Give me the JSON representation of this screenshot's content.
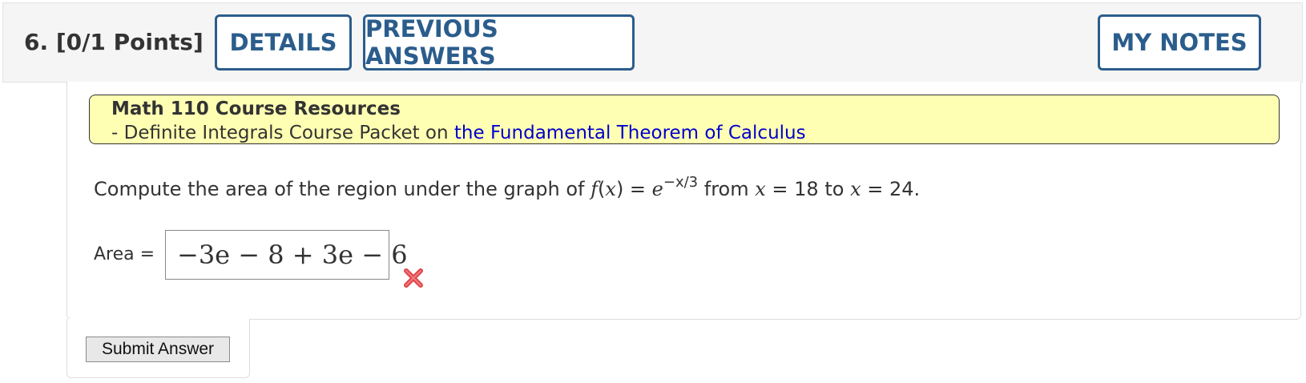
{
  "header": {
    "question_label": "6.  [0/1 Points]",
    "details_label": "DETAILS",
    "previous_answers_label": "PREVIOUS ANSWERS",
    "my_notes_label": "MY NOTES"
  },
  "resources": {
    "title": "Math 110 Course Resources",
    "prefix": "- Definite Integrals Course Packet on ",
    "link": "the Fundamental Theorem of Calculus"
  },
  "question": {
    "part1": "Compute the area of the region under the graph of ",
    "f": "f",
    "part2": "(",
    "x1": "x",
    "part3": ") = ",
    "e": "e",
    "exponent": "−x/3",
    "part4": " from ",
    "x2": "x",
    "part5": " = 18 to ",
    "x3": "x",
    "part6": " = 24."
  },
  "answer": {
    "label": "Area =",
    "value": "−3e − 8 + 3e − 6",
    "status": "incorrect",
    "status_icon": "x-mark-icon",
    "status_color": "#e0454a"
  },
  "submit_label": "Submit Answer"
}
